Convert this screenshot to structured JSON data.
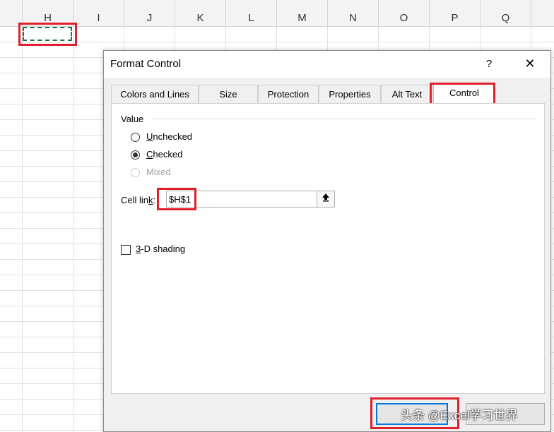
{
  "sheet": {
    "columns": [
      "H",
      "I",
      "J",
      "K",
      "L",
      "M",
      "N",
      "O",
      "P",
      "Q"
    ]
  },
  "dialog": {
    "title": "Format Control",
    "help_glyph": "?",
    "close_glyph": "✕",
    "tabs": [
      {
        "label": "Colors and Lines",
        "active": false
      },
      {
        "label": "Size",
        "active": false
      },
      {
        "label": "Protection",
        "active": false
      },
      {
        "label": "Properties",
        "active": false
      },
      {
        "label": "Alt Text",
        "active": false
      },
      {
        "label": "Control",
        "active": true
      }
    ],
    "value_group": {
      "label": "Value",
      "options": [
        {
          "underline": "U",
          "rest": "nchecked",
          "state": "unchecked",
          "enabled": true
        },
        {
          "underline": "C",
          "rest": "hecked",
          "state": "checked",
          "enabled": true
        },
        {
          "underline": "",
          "rest": "Mixed",
          "state": "unchecked",
          "enabled": false
        }
      ]
    },
    "cell_link": {
      "label_pre": "Cell lin",
      "label_underline": "k",
      "label_post": ":",
      "value": "$H$1",
      "collapse_icon": "upload-arrow-icon"
    },
    "shading": {
      "label_underline": "3",
      "label_rest": "-D shading",
      "checked": false
    },
    "watermark": "头条 @Excel学习世界"
  },
  "colors": {
    "highlight": "#e0202a",
    "marquee": "#217346",
    "ok_border": "#0078d7"
  }
}
